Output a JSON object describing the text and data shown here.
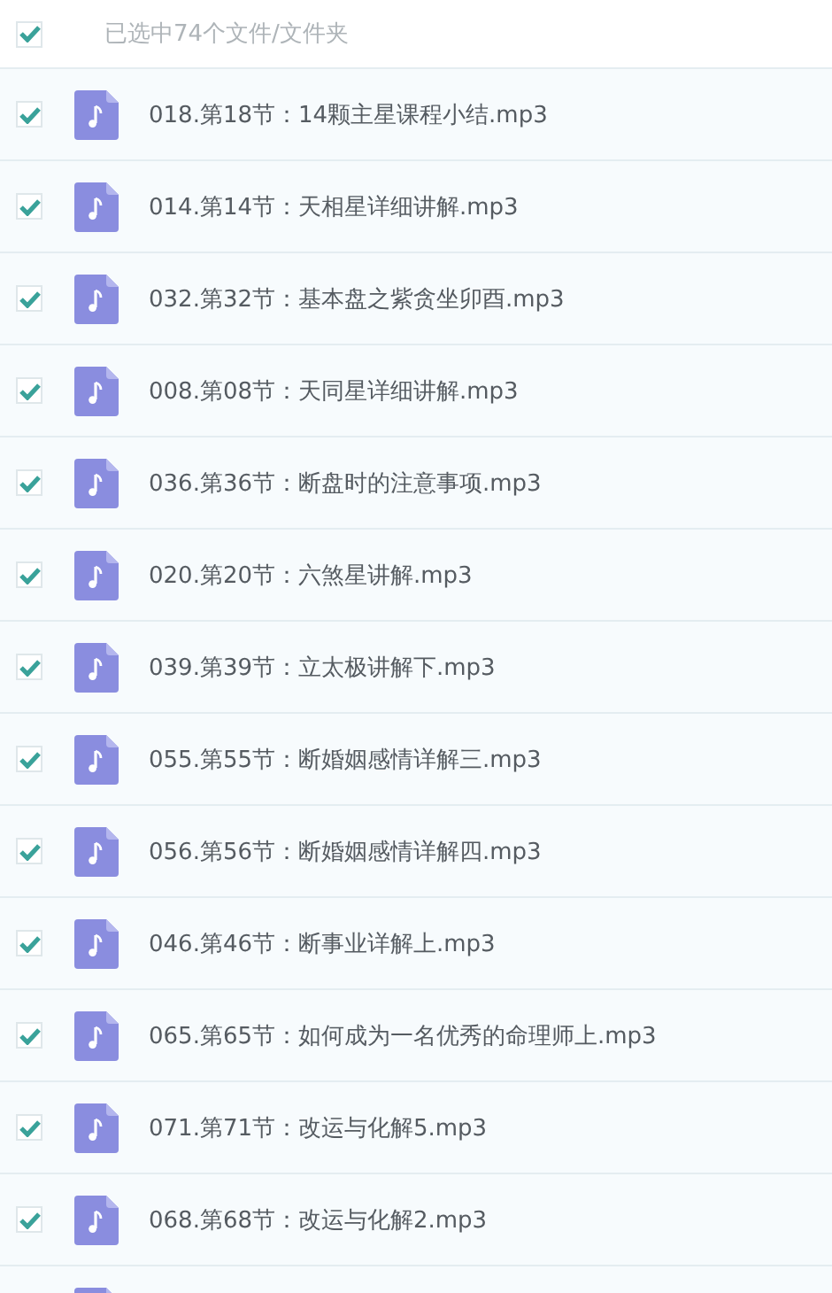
{
  "header": {
    "checked": true,
    "label": "已选中74个文件/文件夹"
  },
  "files": [
    {
      "checked": true,
      "name": "018.第18节：14颗主星课程小结.mp3"
    },
    {
      "checked": true,
      "name": "014.第14节：天相星详细讲解.mp3"
    },
    {
      "checked": true,
      "name": "032.第32节：基本盘之紫贪坐卯酉.mp3"
    },
    {
      "checked": true,
      "name": "008.第08节：天同星详细讲解.mp3"
    },
    {
      "checked": true,
      "name": "036.第36节：断盘时的注意事项.mp3"
    },
    {
      "checked": true,
      "name": "020.第20节：六煞星讲解.mp3"
    },
    {
      "checked": true,
      "name": "039.第39节：立太极讲解下.mp3"
    },
    {
      "checked": true,
      "name": "055.第55节：断婚姻感情详解三.mp3"
    },
    {
      "checked": true,
      "name": "056.第56节：断婚姻感情详解四.mp3"
    },
    {
      "checked": true,
      "name": "046.第46节：断事业详解上.mp3"
    },
    {
      "checked": true,
      "name": "065.第65节：如何成为一名优秀的命理师上.mp3"
    },
    {
      "checked": true,
      "name": "071.第71节：改运与化解5.mp3"
    },
    {
      "checked": true,
      "name": "068.第68节：改运与化解2.mp3"
    }
  ]
}
